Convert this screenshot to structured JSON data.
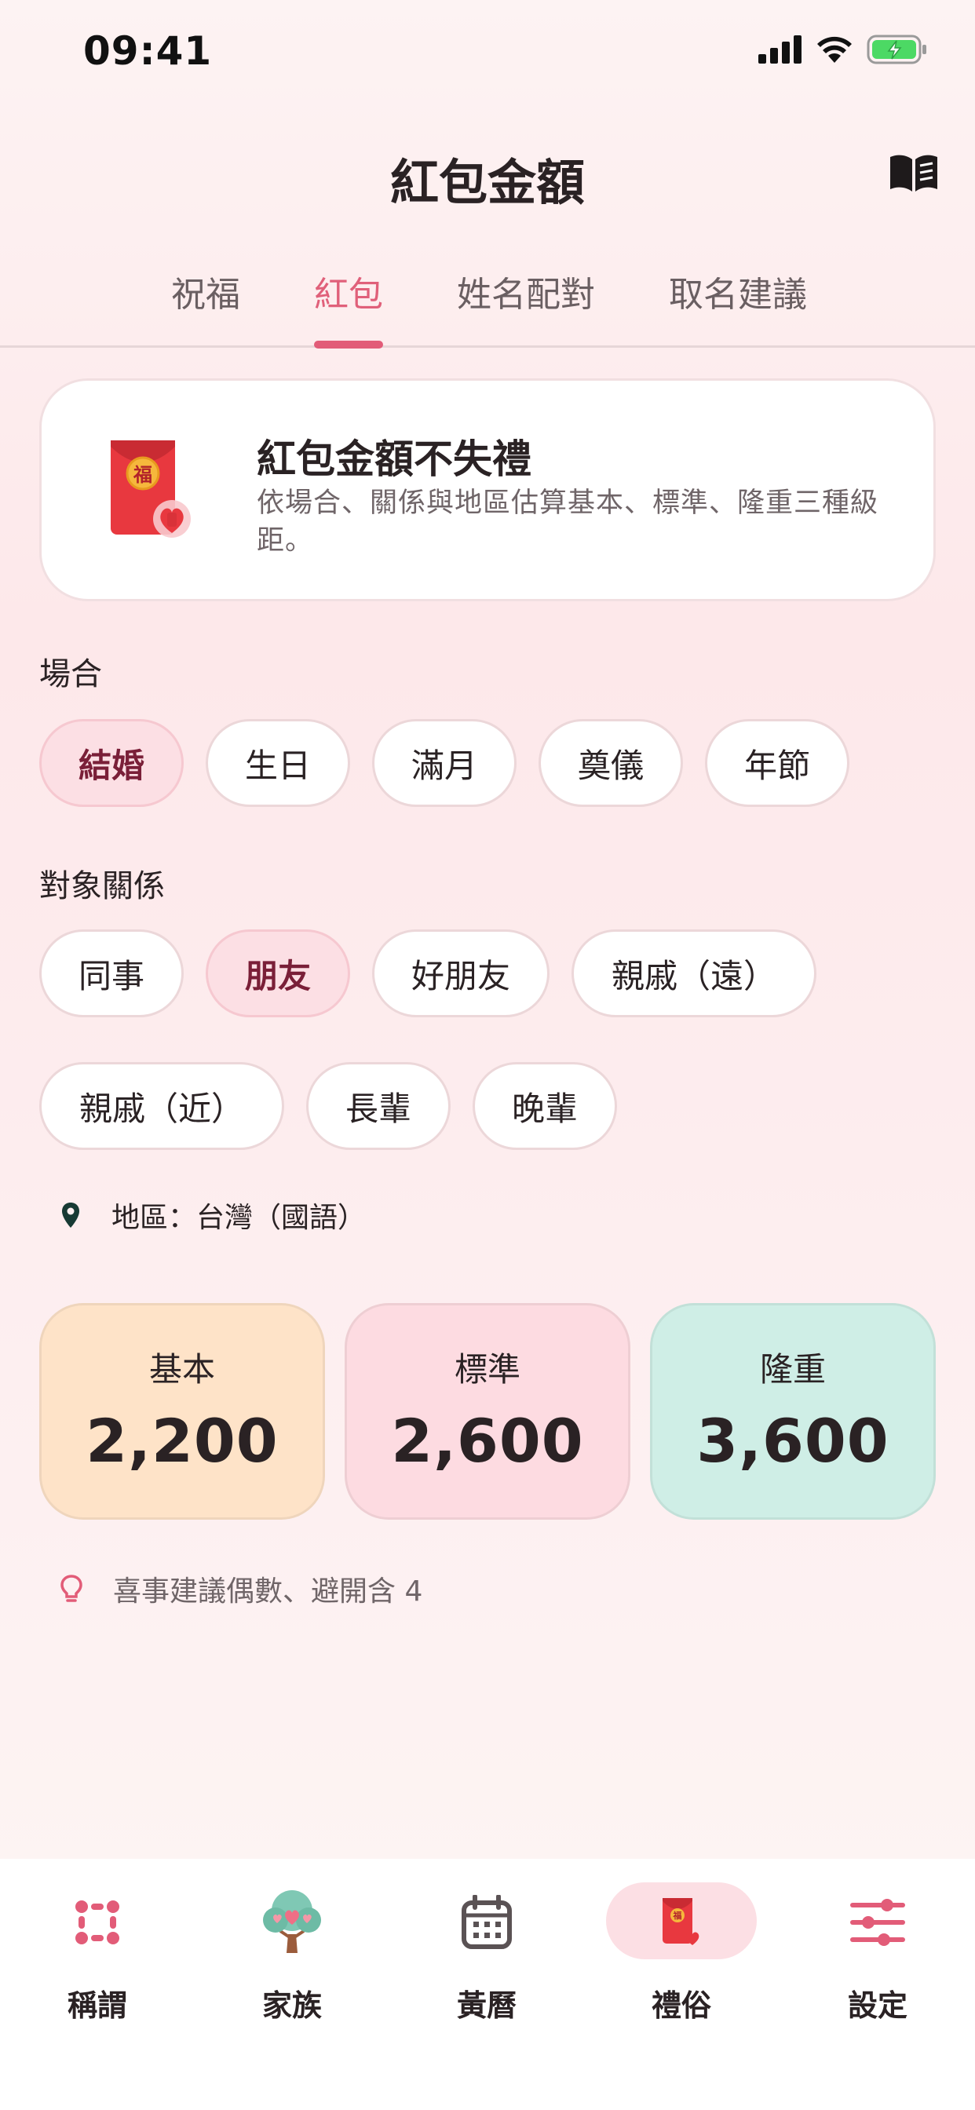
{
  "status_bar": {
    "time": "09:41"
  },
  "header": {
    "title": "紅包金額",
    "guide_icon": "book-icon"
  },
  "tabs": [
    {
      "label": "祝福",
      "active": false
    },
    {
      "label": "紅包",
      "active": true
    },
    {
      "label": "姓名配對",
      "active": false
    },
    {
      "label": "取名建議",
      "active": false
    }
  ],
  "intro": {
    "title": "紅包金額不失禮",
    "description": "依場合、關係與地區估算基本、標準、隆重三種級距。",
    "badge_char": "福"
  },
  "occasion": {
    "label": "場合",
    "options": [
      "結婚",
      "生日",
      "滿月",
      "奠儀",
      "年節"
    ],
    "selected": "結婚"
  },
  "relation": {
    "label": "對象關係",
    "options": [
      "同事",
      "朋友",
      "好朋友",
      "親戚（遠）",
      "親戚（近）",
      "長輩",
      "晚輩"
    ],
    "selected": "朋友"
  },
  "region": {
    "text": "地區：台灣（國語）",
    "icon": "location-pin-icon"
  },
  "amounts": [
    {
      "label": "基本",
      "value": "2,200",
      "color": "#fee3c8"
    },
    {
      "label": "標準",
      "value": "2,600",
      "color": "#fddbe1"
    },
    {
      "label": "隆重",
      "value": "3,600",
      "color": "#cfeee6"
    }
  ],
  "tip": {
    "text": "喜事建議偶數、避開含 4",
    "icon": "lightbulb-icon"
  },
  "bottom_nav": [
    {
      "label": "稱謂",
      "icon": "grid-dots-icon",
      "active": false
    },
    {
      "label": "家族",
      "icon": "family-tree-icon",
      "active": false
    },
    {
      "label": "黃曆",
      "icon": "calendar-icon",
      "active": false
    },
    {
      "label": "禮俗",
      "icon": "red-envelope-icon",
      "active": true
    },
    {
      "label": "設定",
      "icon": "sliders-icon",
      "active": false
    }
  ],
  "colors": {
    "accent": "#e25c78",
    "selected_chip_bg": "#fcdfe4",
    "selected_chip_text": "#7a1f38"
  }
}
